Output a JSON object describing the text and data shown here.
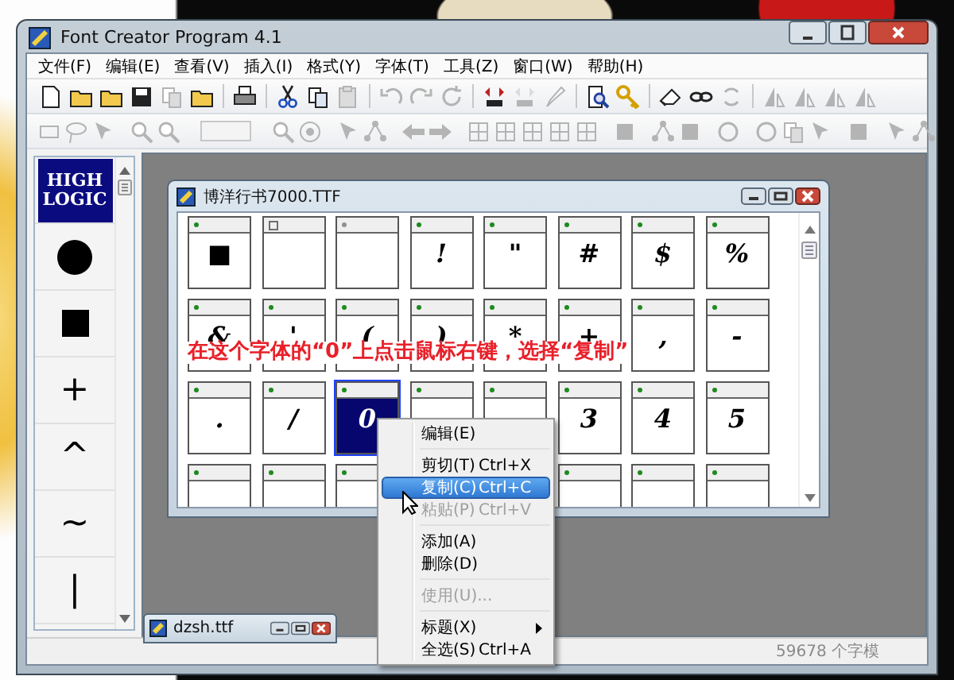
{
  "window": {
    "title": "Font Creator Program 4.1"
  },
  "menu": [
    "文件(F)",
    "编辑(E)",
    "查看(V)",
    "插入(I)",
    "格式(Y)",
    "字体(T)",
    "工具(Z)",
    "窗口(W)",
    "帮助(H)"
  ],
  "toolbars": [
    [
      {
        "kind": "button",
        "disabled": false
      },
      {
        "kind": "button",
        "disabled": false
      },
      {
        "kind": "button",
        "disabled": false
      },
      {
        "kind": "button",
        "disabled": false
      },
      {
        "kind": "button",
        "disabled": true
      },
      {
        "kind": "button",
        "disabled": false
      },
      {
        "kind": "separator"
      },
      {
        "kind": "button",
        "disabled": false
      },
      {
        "kind": "separator"
      },
      {
        "kind": "button",
        "disabled": false
      },
      {
        "kind": "button",
        "disabled": false
      },
      {
        "kind": "button",
        "disabled": true
      },
      {
        "kind": "separator"
      },
      {
        "kind": "button",
        "disabled": true
      },
      {
        "kind": "button",
        "disabled": true
      },
      {
        "kind": "button",
        "disabled": true
      },
      {
        "kind": "separator"
      },
      {
        "kind": "button",
        "disabled": false
      },
      {
        "kind": "button",
        "disabled": true
      },
      {
        "kind": "button",
        "disabled": true
      },
      {
        "kind": "separator"
      },
      {
        "kind": "button",
        "disabled": false
      },
      {
        "kind": "button",
        "disabled": false
      },
      {
        "kind": "separator"
      },
      {
        "kind": "button",
        "disabled": false
      },
      {
        "kind": "button",
        "disabled": false
      },
      {
        "kind": "button",
        "disabled": true
      },
      {
        "kind": "separator"
      },
      {
        "kind": "button",
        "disabled": true
      },
      {
        "kind": "button",
        "disabled": true
      },
      {
        "kind": "button",
        "disabled": true
      },
      {
        "kind": "button",
        "disabled": true
      }
    ],
    [
      {
        "kind": "button",
        "disabled": true
      },
      {
        "kind": "button",
        "disabled": true
      },
      {
        "kind": "button",
        "disabled": true
      },
      {
        "kind": "separator"
      },
      {
        "kind": "button",
        "disabled": true
      },
      {
        "kind": "button",
        "disabled": true
      },
      {
        "kind": "separator"
      },
      {
        "kind": "field",
        "disabled": true
      },
      {
        "kind": "separator"
      },
      {
        "kind": "button",
        "disabled": true
      },
      {
        "kind": "button",
        "disabled": true
      },
      {
        "kind": "separator"
      },
      {
        "kind": "button",
        "disabled": true
      },
      {
        "kind": "button",
        "disabled": true
      },
      {
        "kind": "separator"
      },
      {
        "kind": "button",
        "disabled": true
      },
      {
        "kind": "button",
        "disabled": true
      },
      {
        "kind": "separator"
      },
      {
        "kind": "button",
        "disabled": true
      },
      {
        "kind": "button",
        "disabled": true
      },
      {
        "kind": "button",
        "disabled": true
      },
      {
        "kind": "button",
        "disabled": true
      },
      {
        "kind": "button",
        "disabled": true
      },
      {
        "kind": "separator"
      },
      {
        "kind": "button",
        "disabled": true
      },
      {
        "kind": "separator"
      },
      {
        "kind": "button",
        "disabled": true
      },
      {
        "kind": "button",
        "disabled": true
      },
      {
        "kind": "separator"
      },
      {
        "kind": "button",
        "disabled": true
      },
      {
        "kind": "separator"
      },
      {
        "kind": "button",
        "disabled": true
      },
      {
        "kind": "button",
        "disabled": true
      },
      {
        "kind": "button",
        "disabled": true
      },
      {
        "kind": "separator"
      },
      {
        "kind": "button",
        "disabled": true
      },
      {
        "kind": "separator"
      },
      {
        "kind": "button",
        "disabled": true
      },
      {
        "kind": "button",
        "disabled": true
      }
    ]
  ],
  "palette": [
    {
      "kind": "logo",
      "text": "HIGH LOGIC"
    },
    {
      "kind": "circle"
    },
    {
      "kind": "square"
    },
    {
      "kind": "symbol",
      "text": "+"
    },
    {
      "kind": "symbol",
      "text": "^"
    },
    {
      "kind": "symbol",
      "text": "~"
    },
    {
      "kind": "symbol",
      "text": "|"
    }
  ],
  "font_window": {
    "title": "博洋行书7000.TTF",
    "glyphs": [
      {
        "glyph": "■",
        "kind": "dot",
        "color": "#1e8a1e",
        "selected": false
      },
      {
        "kind": "box",
        "color": "#707070",
        "selected": false
      },
      {
        "kind": "dot",
        "color": "#909090",
        "selected": false
      },
      {
        "glyph": "!",
        "kind": "dot",
        "color": "#1e8a1e",
        "selected": false
      },
      {
        "glyph": "\"",
        "kind": "dot",
        "color": "#1e8a1e",
        "selected": false
      },
      {
        "glyph": "#",
        "kind": "dot",
        "color": "#1e8a1e",
        "selected": false
      },
      {
        "glyph": "$",
        "kind": "dot",
        "color": "#1e8a1e",
        "selected": false
      },
      {
        "glyph": "%",
        "kind": "dot",
        "color": "#1e8a1e",
        "selected": false
      },
      {
        "glyph": "&",
        "kind": "dot",
        "color": "#1e8a1e",
        "selected": false
      },
      {
        "glyph": "'",
        "kind": "dot",
        "color": "#1e8a1e",
        "selected": false
      },
      {
        "glyph": "(",
        "kind": "dot",
        "color": "#1e8a1e",
        "selected": false
      },
      {
        "glyph": ")",
        "kind": "dot",
        "color": "#1e8a1e",
        "selected": false
      },
      {
        "glyph": "*",
        "kind": "dot",
        "color": "#1e8a1e",
        "selected": false
      },
      {
        "glyph": "+",
        "kind": "dot",
        "color": "#1e8a1e",
        "selected": false
      },
      {
        "glyph": ",",
        "kind": "dot",
        "color": "#1e8a1e",
        "selected": false
      },
      {
        "glyph": "-",
        "kind": "dot",
        "color": "#1e8a1e",
        "selected": false
      },
      {
        "glyph": ".",
        "kind": "dot",
        "color": "#1e8a1e",
        "selected": false
      },
      {
        "glyph": "/",
        "kind": "dot",
        "color": "#1e8a1e",
        "selected": false
      },
      {
        "glyph": "0",
        "kind": "dot",
        "color": "#1e8a1e",
        "selected": true
      },
      {
        "kind": "dot",
        "color": "#1e8a1e",
        "selected": false
      },
      {
        "kind": "dot",
        "color": "#1e8a1e",
        "selected": false
      },
      {
        "glyph": "3",
        "kind": "dot",
        "color": "#1e8a1e",
        "selected": false
      },
      {
        "glyph": "4",
        "kind": "dot",
        "color": "#1e8a1e",
        "selected": false
      },
      {
        "glyph": "5",
        "kind": "dot",
        "color": "#1e8a1e",
        "selected": false
      },
      {
        "kind": "dot",
        "color": "#1e8a1e",
        "selected": false
      },
      {
        "kind": "dot",
        "color": "#1e8a1e",
        "selected": false
      },
      {
        "kind": "dot",
        "color": "#1e8a1e",
        "selected": false
      },
      {
        "kind": "hidden"
      },
      {
        "kind": "hidden"
      },
      {
        "kind": "dot",
        "color": "#1e8a1e",
        "selected": false
      },
      {
        "kind": "dot",
        "color": "#1e8a1e",
        "selected": false
      },
      {
        "kind": "dot",
        "color": "#1e8a1e",
        "selected": false
      }
    ]
  },
  "annotation": "在这个字体的“0”上点击鼠标右键，选择“复制”",
  "context_menu": [
    {
      "kind": "item",
      "label": "编辑(E)",
      "disabled": false,
      "selected": false,
      "submenu": false
    },
    {
      "kind": "separator"
    },
    {
      "kind": "item",
      "label": "剪切(T)",
      "shortcut": "Ctrl+X",
      "disabled": false,
      "selected": false,
      "submenu": false
    },
    {
      "kind": "item",
      "label": "复制(C)",
      "shortcut": "Ctrl+C",
      "disabled": false,
      "selected": true,
      "submenu": false
    },
    {
      "kind": "item",
      "label": "粘贴(P)",
      "shortcut": "Ctrl+V",
      "disabled": true,
      "selected": false,
      "submenu": false
    },
    {
      "kind": "separator"
    },
    {
      "kind": "item",
      "label": "添加(A)",
      "disabled": false,
      "selected": false,
      "submenu": false
    },
    {
      "kind": "item",
      "label": "删除(D)",
      "disabled": false,
      "selected": false,
      "submenu": false
    },
    {
      "kind": "separator"
    },
    {
      "kind": "item",
      "label": "使用(U)...",
      "disabled": true,
      "selected": false,
      "submenu": false
    },
    {
      "kind": "separator"
    },
    {
      "kind": "item",
      "label": "标题(X)",
      "disabled": false,
      "selected": false,
      "submenu": true
    },
    {
      "kind": "item",
      "label": "全选(S)",
      "shortcut": "Ctrl+A",
      "disabled": false,
      "selected": false,
      "submenu": false
    }
  ],
  "minimized_window": {
    "title": "dzsh.ttf"
  },
  "status_bar": {
    "glyph_count": "59678 个字模"
  }
}
